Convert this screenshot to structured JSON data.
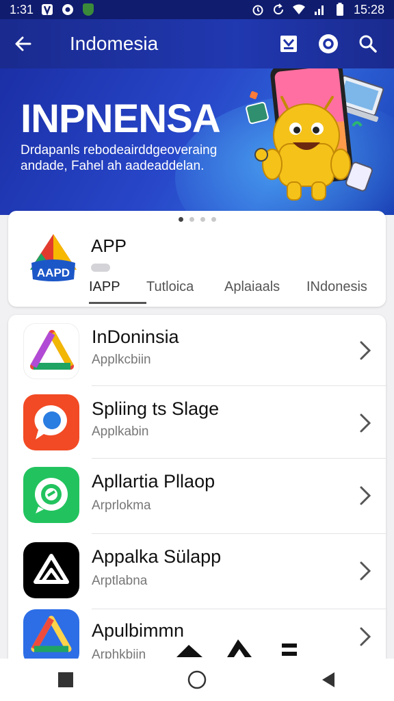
{
  "status_bar": {
    "time_left": "1:31",
    "time_right": "15:28",
    "icons": [
      "notification-icon",
      "circle-icon",
      "shield-icon",
      "alarm-icon",
      "sync-icon",
      "wifi-icon",
      "signal-icon",
      "battery-icon"
    ]
  },
  "app_bar": {
    "title": "Indomesia",
    "icons": [
      "back-arrow-icon",
      "download-icon",
      "camera-icon",
      "search-icon"
    ]
  },
  "banner": {
    "heading": "INPNENSA",
    "subtitle": "Drdapanls rebodeairddgeoveraing andade, Fahel ah aadeaddelan."
  },
  "featured": {
    "page_dots": 4,
    "active_dot": 0,
    "app_name": "APP",
    "logo_text": "AAPD",
    "tabs": [
      "IAPP",
      "Tutloica",
      "Aplaiaals",
      "INdonesis"
    ],
    "active_tab": 0
  },
  "apps": [
    {
      "title": "InDoninsia",
      "subtitle": "Applkcbiin",
      "icon": "triangle-logo-icon",
      "bg": "#ffffff"
    },
    {
      "title": "Spliing ts Slage",
      "subtitle": "Applkabin",
      "icon": "chat-bubble-icon",
      "bg": "#f24a24"
    },
    {
      "title": "Apllartia Pllaop",
      "subtitle": "Arprlokma",
      "icon": "whatsapp-icon",
      "bg": "#22c35e"
    },
    {
      "title": "Appalka Sülapp",
      "subtitle": "Arptlabna",
      "icon": "mountain-logo-icon",
      "bg": "#000000"
    },
    {
      "title": "Apulbimmn",
      "subtitle": "Arphkbiin",
      "icon": "drive-logo-icon",
      "bg": "#2d6ee6"
    }
  ],
  "nav": [
    "recents-button",
    "home-button",
    "back-button"
  ],
  "colors": {
    "app_bar": "#1f33a8",
    "accent_yellow": "#f5c21a"
  }
}
